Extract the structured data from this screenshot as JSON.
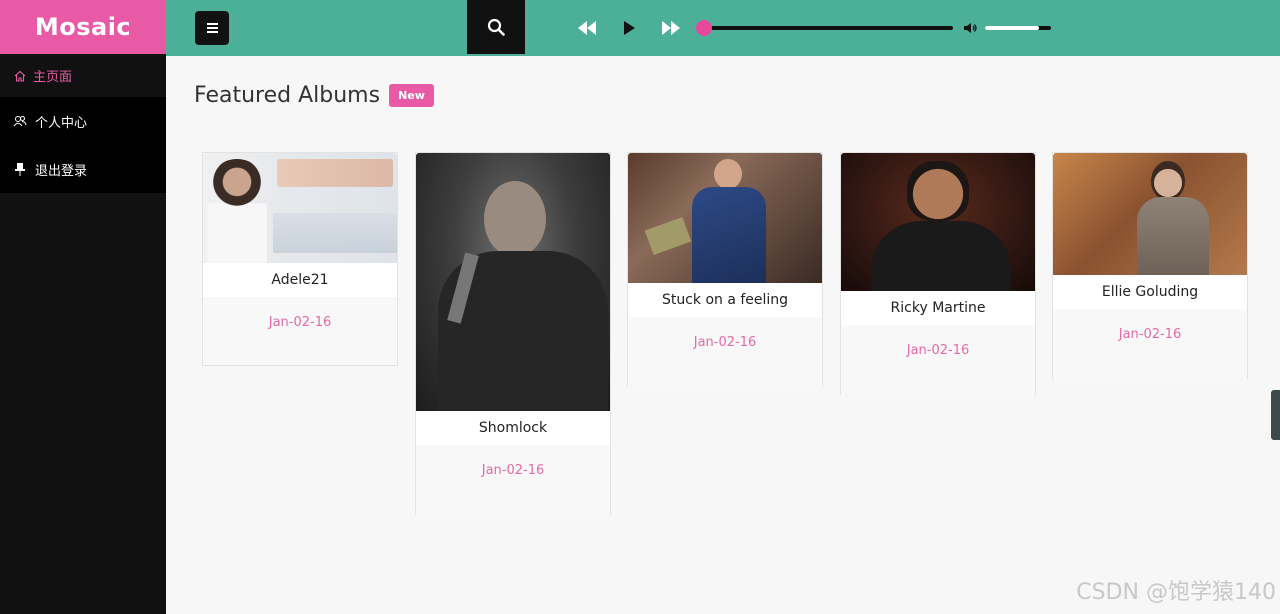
{
  "app": {
    "brand": "Mosaic"
  },
  "sidebar": {
    "items": [
      {
        "label": "主页面",
        "icon": "home-icon",
        "active": true
      },
      {
        "label": "个人中心",
        "icon": "users-icon",
        "active": false
      },
      {
        "label": "退出登录",
        "icon": "pin-icon",
        "active": false
      }
    ]
  },
  "header": {
    "menu_icon": "hamburger-menu-icon",
    "search_icon": "search-icon",
    "player": {
      "rewind_icon": "rewind-icon",
      "play_icon": "play-icon",
      "forward_icon": "fast-forward-icon",
      "progress": 0,
      "volume_icon": "volume-icon",
      "volume": 0.82
    }
  },
  "main": {
    "title": "Featured Albums",
    "badge": "New",
    "albums": [
      {
        "name": "Adele21",
        "date": "Jan-02-16"
      },
      {
        "name": "Shomlock",
        "date": "Jan-02-16"
      },
      {
        "name": "Stuck on a feeling",
        "date": "Jan-02-16"
      },
      {
        "name": "Ricky Martine",
        "date": "Jan-02-16"
      },
      {
        "name": "Ellie Goluding",
        "date": "Jan-02-16"
      }
    ]
  },
  "colors": {
    "accent": "#e85aa5",
    "topbar": "#4caf98",
    "sidebar": "#111111"
  },
  "watermark": "CSDN @饱学猿140"
}
